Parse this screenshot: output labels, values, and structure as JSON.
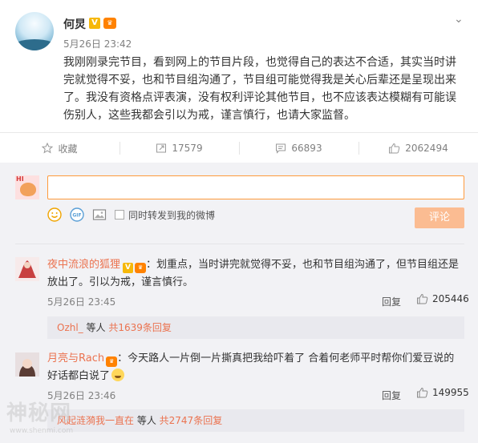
{
  "post": {
    "author": "何炅",
    "verified_badge": "V",
    "time": "5月26日 23:42",
    "content": "我刚刚录完节目，看到网上的节目片段，也觉得自己的表达不合适，其实当时讲完就觉得不妥，也和节目组沟通了，节目组可能觉得我是关心后辈还是呈现出来了。我没有资格点评表演，没有权利评论其他节目，也不应该表达模糊有可能误伤别人，这些我都会引以为戒，谨言慎行，也请大家监督。"
  },
  "actions": {
    "favorite": "收藏",
    "repost_count": "17579",
    "comment_count": "66893",
    "like_count": "2062494"
  },
  "composer": {
    "input_value": "",
    "repost_option": "同时转发到我的微博",
    "submit": "评论"
  },
  "comments": [
    {
      "user": "夜中流浪的狐狸",
      "verified_badge": "V",
      "text": "：划重点，当时讲完就觉得不妥，也和节目组沟通了，但节目组还是放出了。引以为戒，谨言慎行。",
      "time": "5月26日 23:45",
      "reply": "回复",
      "likes": "205446",
      "sub_reply": {
        "user": "Ozhl_",
        "mid": " 等人 ",
        "count": "共1639条回复"
      }
    },
    {
      "user": "月亮与Rach",
      "text": "：今天路人一片倒一片撕真把我给吓着了 合着何老师平时帮你们爱豆说的好话都白说了",
      "time": "5月26日 23:46",
      "reply": "回复",
      "likes": "149955",
      "sub_reply": {
        "user": "风起涟漪我一直在",
        "mid": " 等人 ",
        "count": "共2747条回复"
      }
    }
  ],
  "watermark": {
    "text": "神秘网",
    "url": "www.shenmi.com"
  },
  "colors": {
    "accent": "#eb7350",
    "input_border": "#ff9a3c",
    "submit_bg": "#fbbc92",
    "verified": "#f6b80a"
  }
}
